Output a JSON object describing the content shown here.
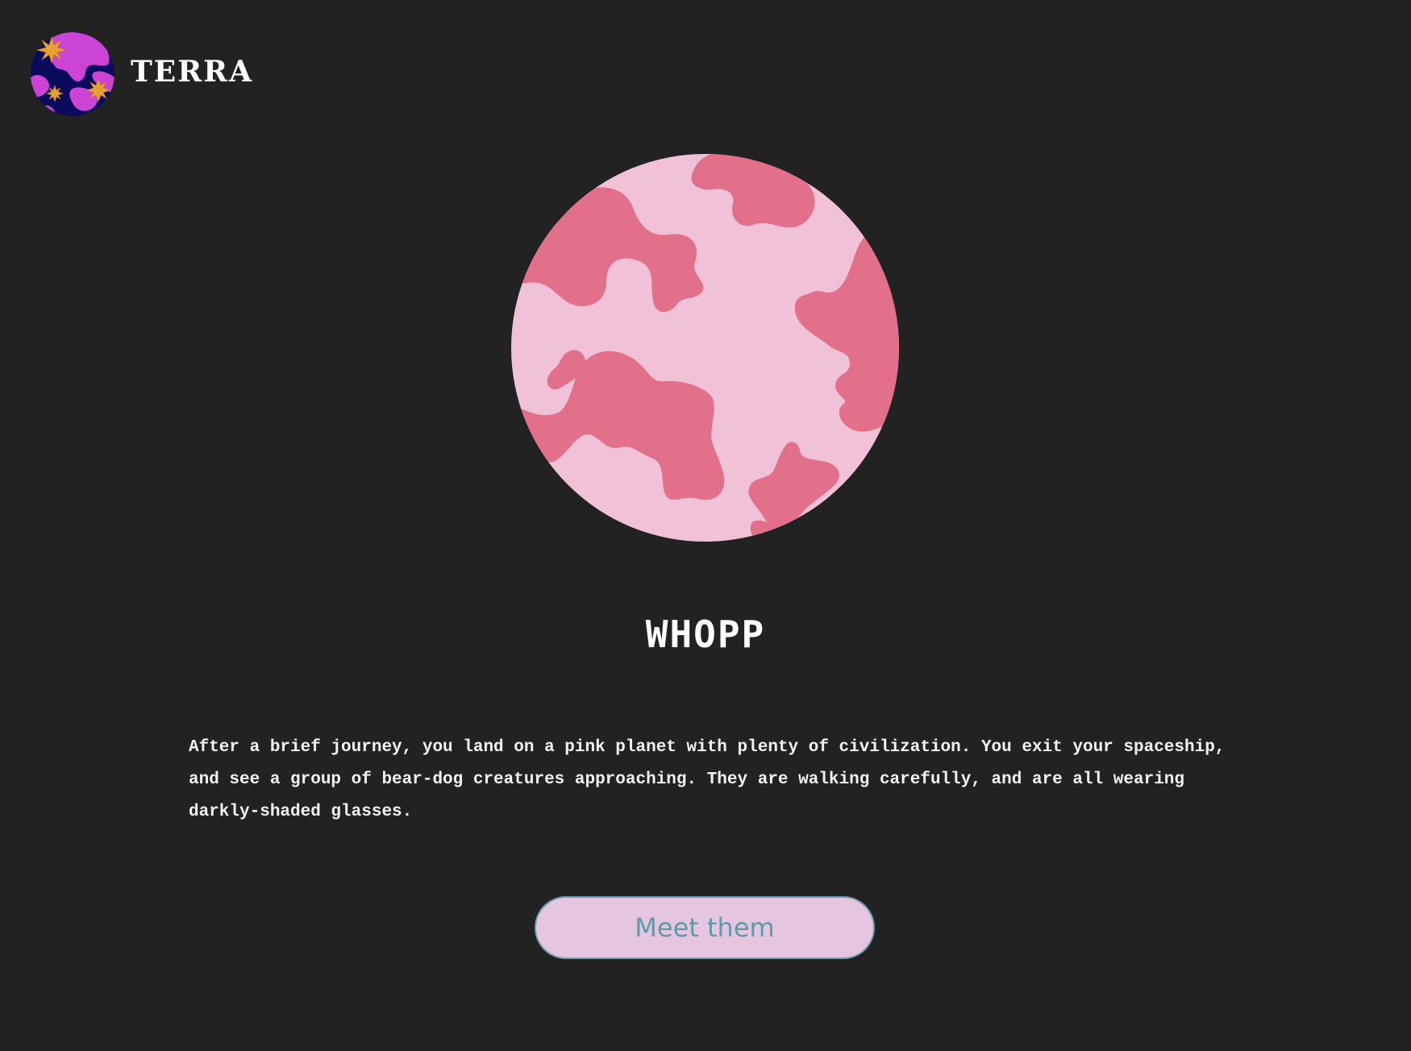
{
  "header": {
    "brand": "TERRA",
    "logo_icon": "globe-with-sparkles-icon"
  },
  "main": {
    "planet_icon": "pink-planet-icon",
    "planet_name": "WHOPP",
    "description": "After a brief journey, you land on a pink planet with plenty of civilization. You exit your spaceship, and see a group of bear-dog creatures approaching. They are walking carefully, and are all wearing darkly-shaded glasses.",
    "cta_label": "Meet them"
  },
  "colors": {
    "background": "#222222",
    "planet_base": "#f1c1d8",
    "planet_land": "#e2708a",
    "logo_ocean": "#0b0b5e",
    "logo_land": "#cc44d6",
    "logo_spark": "#e8a030",
    "button_fill": "#e6c6df",
    "button_text": "#5f9aab"
  }
}
